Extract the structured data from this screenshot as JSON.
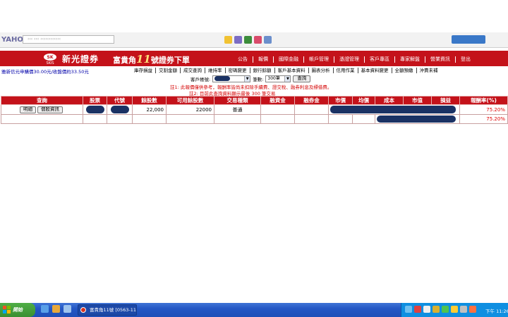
{
  "browser": {
    "logo": "YAHOO!"
  },
  "header": {
    "brand_name": "新光證券",
    "slogan_prefix": "富貴角",
    "slogan_number": "11",
    "slogan_suffix": "號證券下單",
    "nav": [
      "公告",
      "報價",
      "國際金融",
      "帳戶管理",
      "憑證管理",
      "客戶專區",
      "專家解盤",
      "營業資訊",
      "登出"
    ]
  },
  "ticker": {
    "text": "雅新信元申購價30.00元/收盤價約33.50元"
  },
  "sub_nav": [
    "庫存損益",
    "交割金額",
    "成交查詢",
    "維持率",
    "密碼變更",
    "銀行餘額",
    "客戶基本資料",
    "圖表分析",
    "信用作業",
    "基本資料變更",
    "全額預繳",
    "沖賣未補"
  ],
  "account": {
    "label": "客戶帳號:",
    "count_label": "筆數:",
    "count_value": "300筆",
    "query_button": "查詢"
  },
  "notes": {
    "note1": "註1: 此報價僅供參考，報酬率皆尚未扣除手續費、證交稅、融券利息及標借費。",
    "note2": "註2: 目前此查詢資料顯示最後 300 筆交易"
  },
  "table": {
    "headers": [
      "查詢",
      "股票",
      "代號",
      "餘股數",
      "可用餘股數",
      "交易種類",
      "融資金",
      "融券金",
      "市價",
      "均價",
      "成本",
      "市值",
      "損益",
      "報酬率(%)"
    ],
    "rows": [
      {
        "btn_detail": "明細",
        "btn_quote": "個股資訊",
        "balance": "22,000",
        "available": "22000",
        "trade_type": "普通",
        "return_pct": "75.20%"
      }
    ],
    "total_return": "75.20%"
  },
  "taskbar": {
    "start": "開始",
    "task_item": "富貴角11號 [0563-11...",
    "clock": "下午 11:26"
  },
  "colors": {
    "brand_red": "#c4121a",
    "taskbar_blue": "#2457c5",
    "mask_navy": "#1b3264"
  }
}
